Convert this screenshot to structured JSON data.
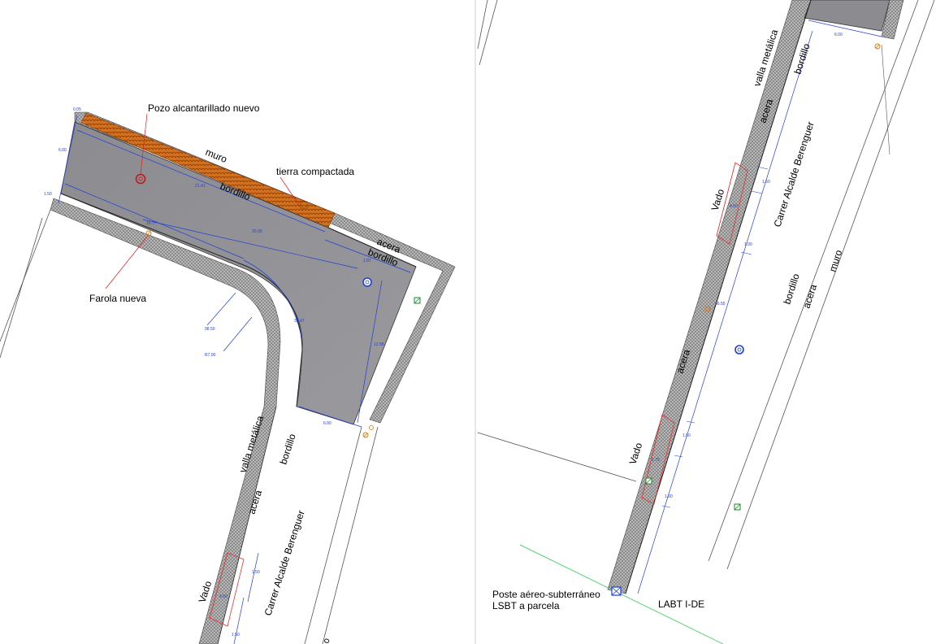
{
  "annotations": {
    "pozo": "Pozo alcantarillado nuevo",
    "tierra": "tierra compactada",
    "farola": "Farola nueva",
    "poste_line1": "Poste aéreo-subterráneo",
    "poste_line2": "LSBT a parcela",
    "labt": "LABT I-DE"
  },
  "labels": {
    "muro": "muro",
    "bordillo": "bordillo",
    "acera": "acera",
    "valla": "valla metálica",
    "vado": "Vado",
    "street": "Carrer Alcalde Berenguer"
  },
  "dimensions": {
    "d_005": "0.05",
    "d_600": "6.00",
    "d_150": "1.50",
    "d_2141": "21.41",
    "d_1577": "15.77",
    "d_2000": "20.00",
    "d_187": "1.87",
    "d_r9850": "98.50",
    "d_r8700": "R7.00",
    "d_3247": "32.47",
    "d_1258": "12.58",
    "d_600b": "6.00",
    "d_150b": "1.50",
    "d_450": "4.50",
    "d_4655": "46.55",
    "d_100": "1.00",
    "d_175": "1.75"
  },
  "colors": {
    "road": "#8a8a8e",
    "sidewalk": "#b8b8b8",
    "soil": "#c8641a",
    "dimension": "#1f3fd6",
    "leader": "#e01b1b",
    "labt_line": "#5ad17a"
  },
  "symbols": {
    "manhole": "manhole-icon",
    "streetlight": "streetlight-icon",
    "junction_box": "junction-box-icon",
    "utility_pole": "utility-pole-icon"
  }
}
